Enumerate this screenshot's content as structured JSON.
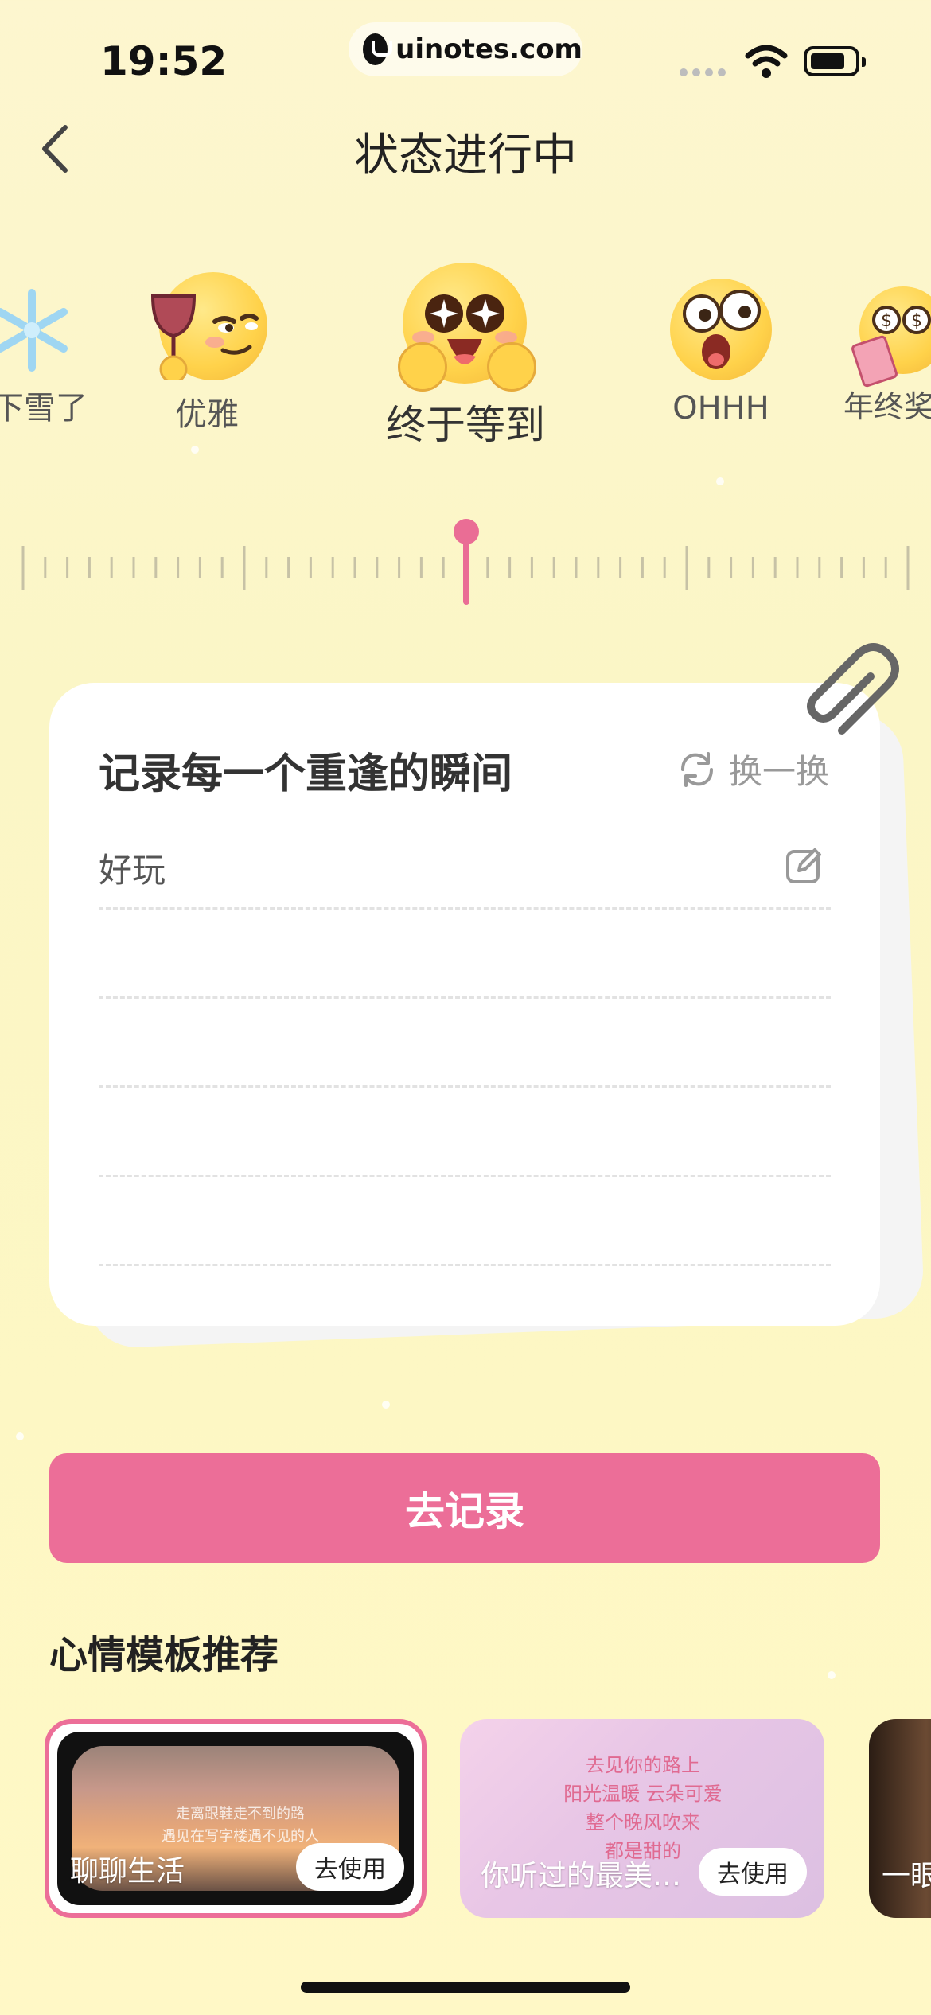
{
  "status_bar": {
    "time": "19:52",
    "url": "uinotes.com"
  },
  "nav": {
    "title": "状态进行中"
  },
  "emoji_picker": {
    "items": [
      {
        "label": "下雪了",
        "icon": "snowflake-icon"
      },
      {
        "label": "优雅",
        "icon": "elegant-wine-emoji"
      },
      {
        "label": "终于等到",
        "icon": "starry-eyes-emoji",
        "selected": true
      },
      {
        "label": "OHHH",
        "icon": "surprised-emoji"
      },
      {
        "label": "年终奖",
        "icon": "money-eyes-emoji"
      }
    ]
  },
  "card": {
    "title": "记录每一个重逢的瞬间",
    "refresh_label": "换一换",
    "note_text": "好玩"
  },
  "primary_button": {
    "label": "去记录"
  },
  "templates": {
    "section_title": "心情模板推荐",
    "items": [
      {
        "label": "聊聊生活",
        "use_label": "去使用",
        "poem": [
          "走离跟鞋走不到的路",
          "遇见在写字楼遇不见的人"
        ]
      },
      {
        "label": "你听过的最美…",
        "use_label": "去使用",
        "poem": [
          "去见你的路上",
          "阳光温暖 云朵可爱",
          "整个晚风吹来",
          "都是甜的"
        ]
      },
      {
        "label": "一眼"
      }
    ]
  },
  "colors": {
    "accent": "#ec6e98",
    "background": "#fdf6cf"
  }
}
